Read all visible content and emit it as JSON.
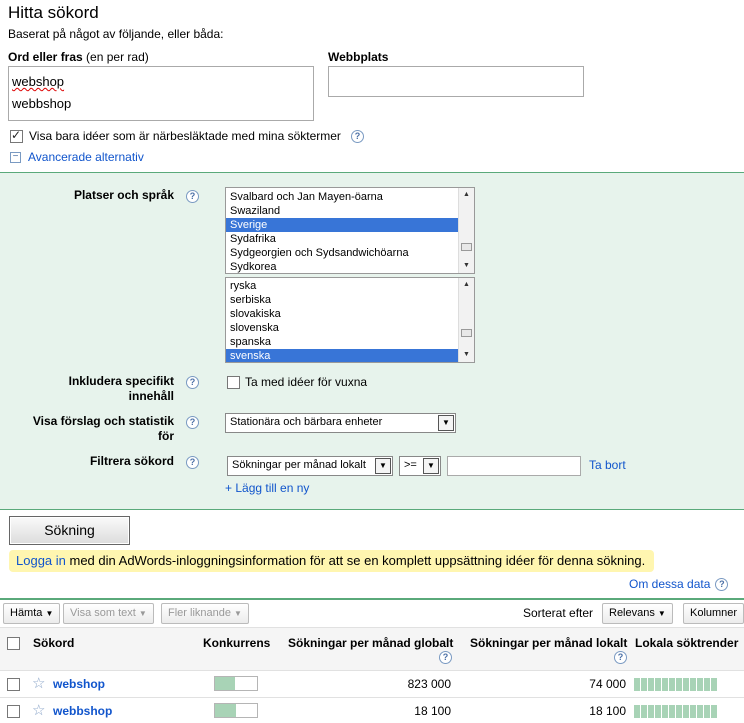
{
  "header": {
    "title": "Hitta sökord",
    "subtitle": "Baserat på något av följande, eller båda:"
  },
  "keywords_field": {
    "label": "Ord eller fras",
    "label_hint": "(en per rad)",
    "lines": [
      "webshop",
      "webbshop"
    ]
  },
  "website_field": {
    "label": "Webbplats",
    "value": ""
  },
  "close_ideas": {
    "checked": true,
    "label": "Visa bara idéer som är närbesläktade med mina söktermer"
  },
  "advanced_toggle": {
    "icon": "minus",
    "label": "Avancerade alternativ"
  },
  "advanced": {
    "locations_label": "Platser och språk",
    "countries": [
      "Svalbard och Jan Mayen-öarna",
      "Swaziland",
      "Sverige",
      "Sydafrika",
      "Sydgeorgien och Sydsandwichöarna",
      "Sydkorea"
    ],
    "country_selected": "Sverige",
    "languages": [
      "ryska",
      "serbiska",
      "slovakiska",
      "slovenska",
      "spanska",
      "svenska"
    ],
    "language_selected": "svenska",
    "adult_label_line1": "Inkludera specifikt",
    "adult_label_line2": "innehåll",
    "adult_checkbox_label": "Ta med idéer för vuxna",
    "adult_checked": false,
    "devices_label_line1": "Visa förslag och statistik",
    "devices_label_line2": "för",
    "devices_value": "Stationära och bärbara enheter",
    "filter_label": "Filtrera sökord",
    "filter_field": "Sökningar per månad lokalt",
    "filter_operator": ">=",
    "filter_value": "",
    "remove_link": "Ta bort",
    "add_link": "+ Lägg till en ny"
  },
  "search_button": "Sökning",
  "notice": {
    "link": "Logga in",
    "text": " med din AdWords-inloggningsinformation för att se en komplett uppsättning idéer för denna sökning."
  },
  "about_data": "Om dessa data",
  "toolbar": {
    "download": "Hämta",
    "view_as_text": "Visa som text",
    "more_like": "Fler liknande",
    "sorted_by_label": "Sorterat efter",
    "sort_value": "Relevans",
    "columns": "Kolumner"
  },
  "table": {
    "headers": {
      "keyword": "Sökord",
      "competition": "Konkurrens",
      "global": "Sökningar per månad globalt",
      "local": "Sökningar per månad lokalt",
      "trends": "Lokala söktrender"
    },
    "rows": [
      {
        "keyword": "webshop",
        "competition": 0.48,
        "global": "823 000",
        "local": "74 000",
        "trend": [
          0.85,
          0.85,
          0.85,
          0.85,
          0.85,
          0.85,
          0.85,
          0.85,
          0.85,
          0.85,
          0.85,
          0.85
        ]
      },
      {
        "keyword": "webbshop",
        "competition": 0.5,
        "global": "18 100",
        "local": "18 100",
        "trend": [
          0.85,
          0.85,
          0.85,
          0.85,
          0.85,
          0.85,
          0.85,
          0.85,
          0.85,
          0.85,
          0.85,
          0.85
        ]
      }
    ]
  },
  "colors": {
    "accent_green": "#5aa97a",
    "panel_bg": "#e7f3ec",
    "link": "#1155cc",
    "selection": "#3875d7",
    "notice_bg": "#fff6b0",
    "bar_fill": "#a8d3b6"
  }
}
